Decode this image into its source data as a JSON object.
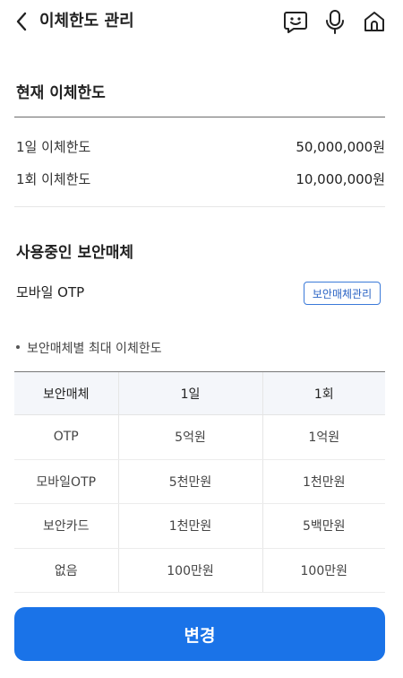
{
  "header": {
    "title": "이체한도 관리",
    "icons": [
      "back-arrow-icon",
      "chatbot-icon",
      "microphone-icon",
      "home-icon"
    ]
  },
  "current_limits": {
    "title": "현재 이체한도",
    "rows": [
      {
        "label": "1일 이체한도",
        "value": "50,000,000원"
      },
      {
        "label": "1회 이체한도",
        "value": "10,000,000원"
      }
    ]
  },
  "security_device": {
    "title": "사용중인 보안매체",
    "name": "모바일 OTP",
    "manage_label": "보안매체관리"
  },
  "max_limits": {
    "note": "보안매체별 최대 이체한도",
    "headers": [
      "보안매체",
      "1일",
      "1회"
    ],
    "rows": [
      [
        "OTP",
        "5억원",
        "1억원"
      ],
      [
        "모바일OTP",
        "5천만원",
        "1천만원"
      ],
      [
        "보안카드",
        "1천만원",
        "5백만원"
      ],
      [
        "없음",
        "100만원",
        "100만원"
      ]
    ]
  },
  "footer": {
    "change_label": "변경"
  },
  "colors": {
    "accent": "#1a73e8",
    "outline_button": "#3b7ad9",
    "table_header_bg": "#f4f6fa"
  }
}
